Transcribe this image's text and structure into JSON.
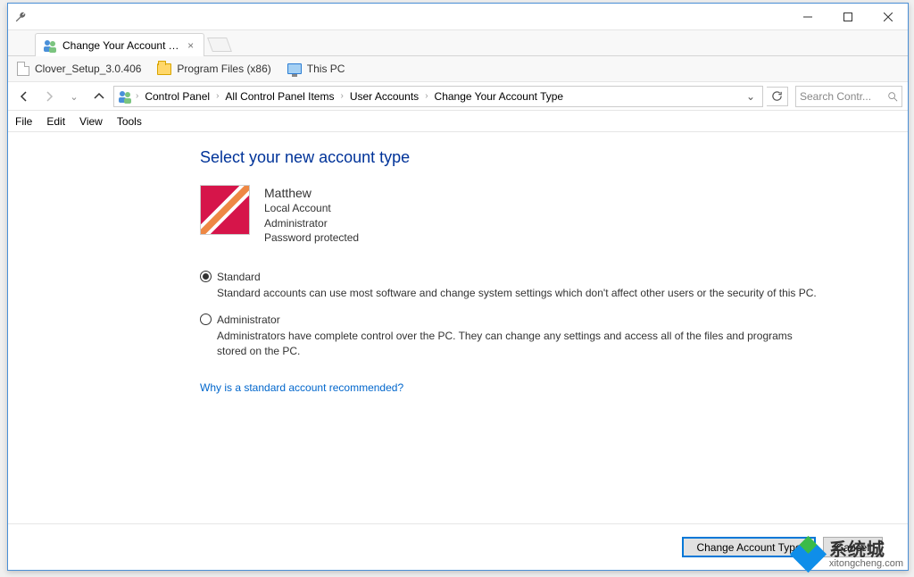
{
  "window": {
    "title": "Change Your Account Type"
  },
  "tab": {
    "title": "Change Your Account Type"
  },
  "bookmarks": [
    {
      "label": "Clover_Setup_3.0.406",
      "icon": "file"
    },
    {
      "label": "Program Files (x86)",
      "icon": "folder"
    },
    {
      "label": "This PC",
      "icon": "pc"
    }
  ],
  "breadcrumb": [
    "Control Panel",
    "All Control Panel Items",
    "User Accounts",
    "Change Your Account Type"
  ],
  "search": {
    "placeholder": "Search Contr..."
  },
  "menubar": [
    "File",
    "Edit",
    "View",
    "Tools"
  ],
  "page": {
    "heading": "Select your new account type",
    "user": {
      "name": "Matthew",
      "line1": "Local Account",
      "line2": "Administrator",
      "line3": "Password protected"
    },
    "options": [
      {
        "label": "Standard",
        "selected": true,
        "desc": "Standard accounts can use most software and change system settings which don't affect other users or the security of this PC."
      },
      {
        "label": "Administrator",
        "selected": false,
        "desc": "Administrators have complete control over the PC. They can change any settings and access all of the files and programs stored on the PC."
      }
    ],
    "help_link": "Why is a standard account recommended?",
    "buttons": {
      "primary": "Change Account Type",
      "cancel": "Cancel"
    }
  },
  "watermark": {
    "title": "系统城",
    "sub": "xitongcheng.com"
  }
}
